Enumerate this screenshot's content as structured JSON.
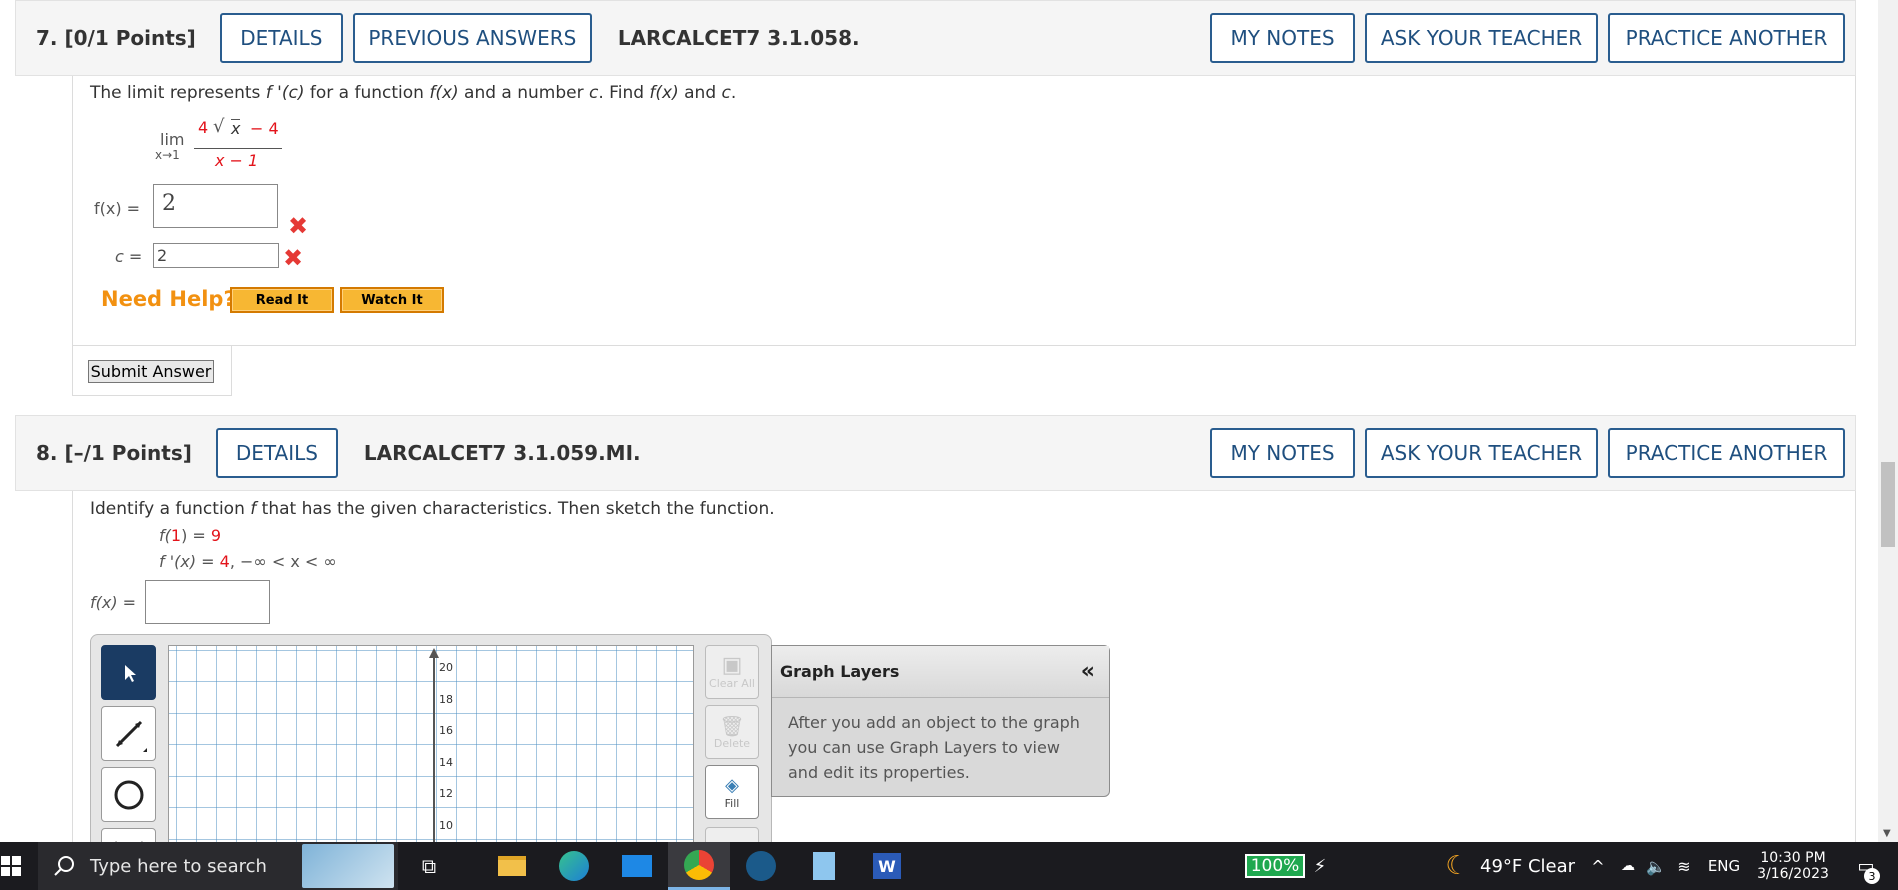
{
  "q7": {
    "number": "7.  [0/1 Points]",
    "details": "DETAILS",
    "previous_answers": "PREVIOUS ANSWERS",
    "id": "LARCALCET7 3.1.058.",
    "my_notes": "MY NOTES",
    "ask_teacher": "ASK YOUR TEACHER",
    "practice": "PRACTICE ANOTHER",
    "prompt_a": "The limit represents ",
    "prompt_fpc": "f '(c)",
    "prompt_b": " for a function ",
    "prompt_fx": "f(x)",
    "prompt_c": " and a number ",
    "prompt_cc": "c",
    "prompt_d": ". Find ",
    "prompt_fx2": "f(x)",
    "prompt_e": " and ",
    "prompt_c2": "c",
    "prompt_f": ".",
    "lim": "lim",
    "lim_sub": "x→1",
    "num_coef": "4",
    "num_rad": "x",
    "num_tail": "− 4",
    "den": "x − 1",
    "fx_label": "f(x) =",
    "fx_value": "2",
    "c_label": "c =",
    "c_value": "2",
    "need_help": "Need Help?",
    "read_it": "Read It",
    "watch_it": "Watch It",
    "submit": "Submit Answer"
  },
  "q8": {
    "number": "8.  [–/1 Points]",
    "details": "DETAILS",
    "id": "LARCALCET7 3.1.059.MI.",
    "my_notes": "MY NOTES",
    "ask_teacher": "ASK YOUR TEACHER",
    "practice": "PRACTICE ANOTHER",
    "prompt_a": "Identify a function ",
    "prompt_f": "f",
    "prompt_b": " that has the given characteristics. Then sketch the function.",
    "cond1_a": "f(",
    "cond1_b": "1",
    "cond1_c": ") = ",
    "cond1_d": "9",
    "cond2_a": "f '(x) = ",
    "cond2_b": "4",
    "cond2_c": ", −∞ < x < ∞",
    "fx_label": "f(x) =",
    "fx_value": "",
    "y_ticks": [
      "20",
      "18",
      "16",
      "14",
      "12",
      "10"
    ],
    "clear_all": "Clear All",
    "delete": "Delete",
    "fill": "Fill",
    "layers_title": "Graph Layers",
    "layers_collapse": "«",
    "layers_text": "After you add an object to the graph you can use Graph Layers to view and edit its properties."
  },
  "taskbar": {
    "search_placeholder": "Type here to search",
    "battery": "100%",
    "weather": "49°F  Clear",
    "lang": "ENG",
    "time": "10:30 PM",
    "date": "3/16/2023",
    "notif_count": "3"
  }
}
